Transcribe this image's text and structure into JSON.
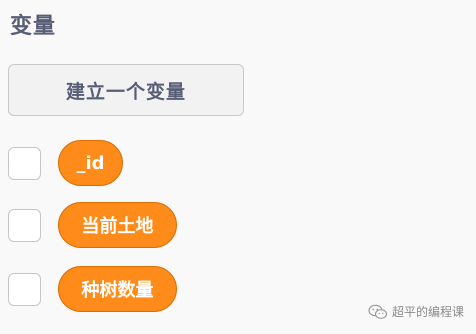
{
  "section": {
    "title": "变量"
  },
  "make_variable_button": {
    "label": "建立一个变量"
  },
  "variables": [
    {
      "name": "_id",
      "checked": false
    },
    {
      "name": "当前土地",
      "checked": false
    },
    {
      "name": "种树数量",
      "checked": false
    }
  ],
  "colors": {
    "reporter_fill": "#ff8c1a",
    "reporter_border": "#db6e00",
    "title_text": "#575e75",
    "background": "#f9f9f9"
  },
  "watermark": {
    "text": "超平的编程课",
    "icon": "wechat-icon"
  }
}
